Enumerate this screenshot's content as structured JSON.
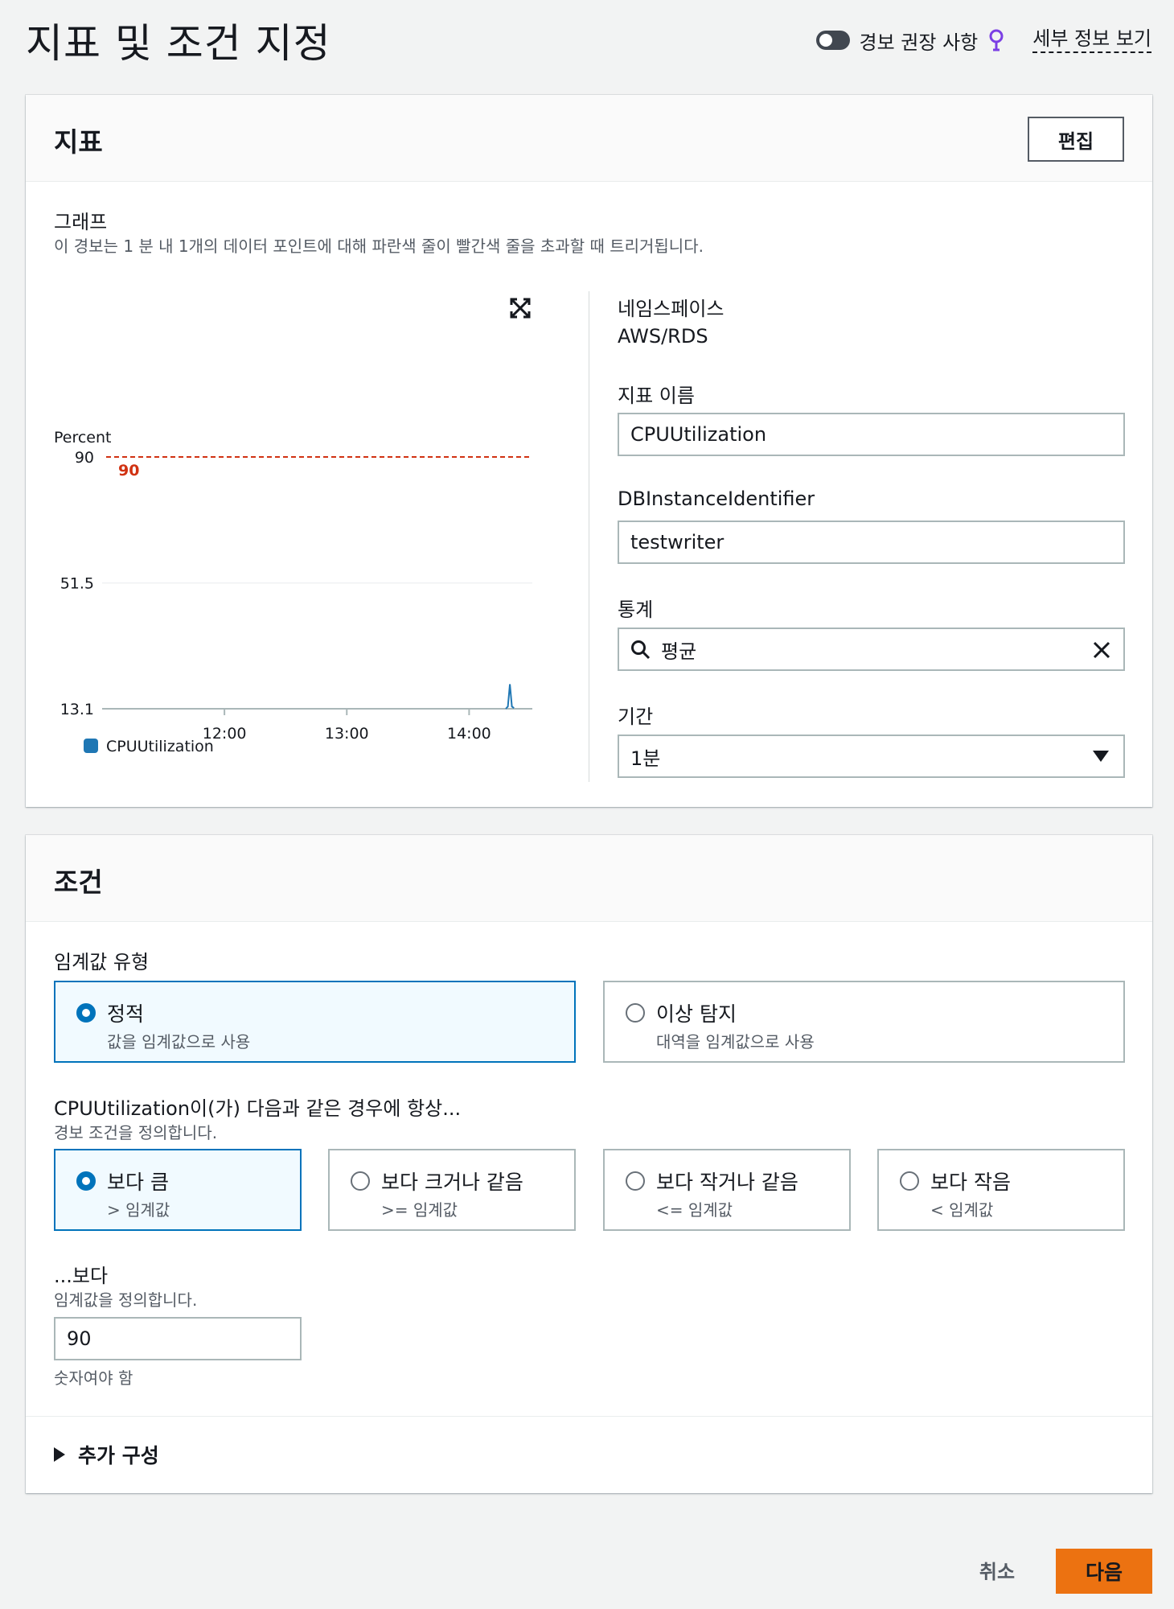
{
  "page": {
    "title": "지표 및 조건 지정",
    "alarm_recommendations_label": "경보 권장 사항",
    "info_link": "세부 정보 보기"
  },
  "metric": {
    "title": "지표",
    "edit_label": "편집",
    "graph_label": "그래프",
    "graph_description": "이 경보는 1 분 내 1개의 데이터 포인트에 대해 파란색 줄이 빨간색 줄을 초과할 때 트리거됩니다.",
    "namespace_label": "네임스페이스",
    "namespace_value": "AWS/RDS",
    "metric_name_label": "지표 이름",
    "metric_name_value": "CPUUtilization",
    "dimension_label": "DBInstanceIdentifier",
    "dimension_value": "testwriter",
    "statistic_label": "통계",
    "statistic_value": "평균",
    "period_label": "기간",
    "period_value": "1분"
  },
  "chart_data": {
    "type": "line",
    "ylabel": "Percent",
    "yticks": [
      "90",
      "51.5",
      "13.1"
    ],
    "ylim": [
      13.1,
      90
    ],
    "xticks": [
      "12:00",
      "13:00",
      "14:00"
    ],
    "threshold": {
      "value": 90,
      "label": "90",
      "color": "#d13212"
    },
    "series": [
      {
        "name": "CPUUtilization",
        "color": "#1f77b4",
        "x": [
          "14:18",
          "14:19",
          "14:20",
          "14:21",
          "14:22"
        ],
        "values": [
          13.1,
          13.8,
          20.6,
          13.8,
          13.3
        ]
      }
    ],
    "grid": true,
    "legend": "bottom-left"
  },
  "conditions": {
    "title": "조건",
    "threshold_type_label": "임계값 유형",
    "threshold_types": [
      {
        "title": "정적",
        "desc": "값을 임계값으로 사용",
        "selected": true
      },
      {
        "title": "이상 탐지",
        "desc": "대역을 임계값으로 사용",
        "selected": false
      }
    ],
    "whenever_label": "CPUUtilization이(가) 다음과 같은 경우에 항상...",
    "whenever_desc": "경보 조건을 정의합니다.",
    "operators": [
      {
        "title": "보다 큼",
        "desc": "> 임계값",
        "selected": true
      },
      {
        "title": "보다 크거나 같음",
        "desc": ">= 임계값",
        "selected": false
      },
      {
        "title": "보다 작거나 같음",
        "desc": "<= 임계값",
        "selected": false
      },
      {
        "title": "보다 작음",
        "desc": "< 임계값",
        "selected": false
      }
    ],
    "than_label": "...보다",
    "than_desc": "임계값을 정의합니다.",
    "threshold_value": "90",
    "threshold_hint": "숫자여야 함",
    "additional_config_label": "추가 구성"
  },
  "footer": {
    "cancel_label": "취소",
    "next_label": "다음"
  },
  "colors": {
    "accent": "#0073bb",
    "primary_button": "#ec7211",
    "threshold_line": "#d13212",
    "series_line": "#1f77b4"
  }
}
